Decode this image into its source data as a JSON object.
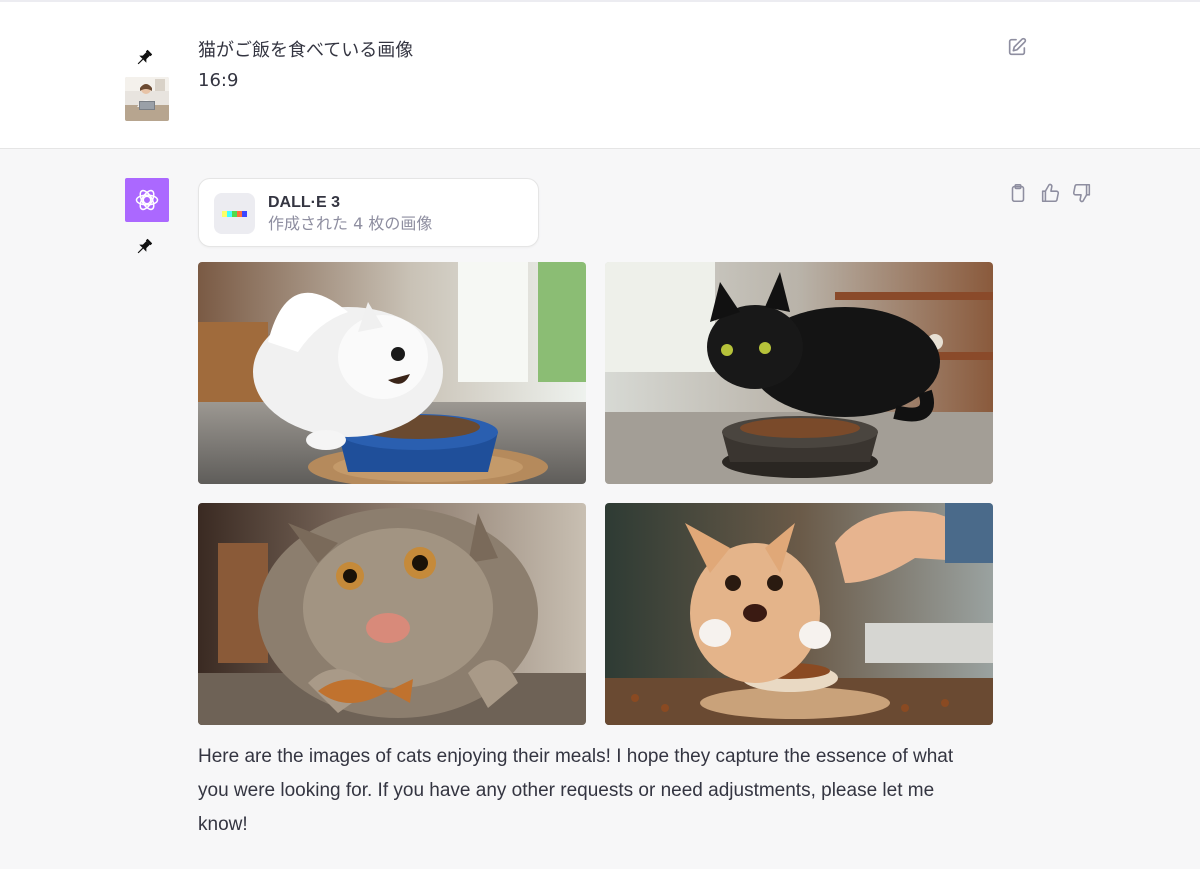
{
  "user": {
    "prompt_line1": "猫がご飯を食べている画像",
    "prompt_line2": "16:9",
    "avatar_icon": "user-photo",
    "pin_icon": "pin-icon",
    "edit_icon": "edit-icon"
  },
  "assistant": {
    "avatar_icon": "openai-logo-icon",
    "avatar_color": "#ab68ff",
    "tool": {
      "name": "DALL·E 3",
      "subtitle": "作成された 4 枚の画像"
    },
    "images": [
      {
        "subject": "white fluffy cat eating from blue bowl"
      },
      {
        "subject": "black cat eating from bowl"
      },
      {
        "subject": "tabby cat with fish-shaped treat"
      },
      {
        "subject": "orange cat being fed by hand"
      }
    ],
    "response": "Here are the images of cats enjoying their meals! I hope they capture the essence of what you were looking for. If you have any other requests or need adjustments, please let me know!",
    "actions": [
      "copy-icon",
      "thumbs-up-icon",
      "thumbs-down-icon"
    ]
  },
  "colors": {
    "user_bg": "#ffffff",
    "assistant_bg": "#f7f7f8",
    "text": "#343541",
    "muted": "#8e8ea0"
  }
}
